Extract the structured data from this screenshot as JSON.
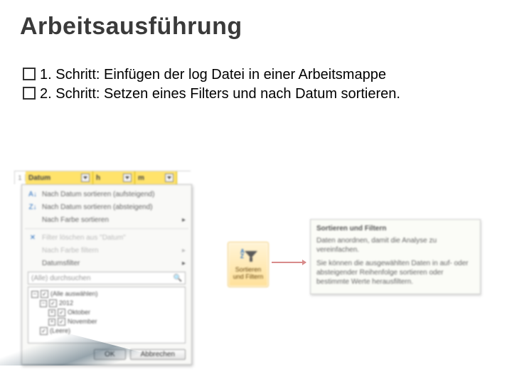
{
  "title": "Arbeitsausführung",
  "bullets": {
    "b1_lead": "1. Schritt:",
    "b1_rest": " Einfügen der log Datei in einer Arbeitsmappe",
    "b2_lead": "2. Schritt:",
    "b2_rest": " Setzen eines Filters und nach Datum sortieren."
  },
  "filter": {
    "row_no": "1",
    "col_a": "Datum",
    "col_b": "h",
    "col_c": "m",
    "menu": {
      "sort_asc": "Nach Datum sortieren (aufsteigend)",
      "sort_desc": "Nach Datum sortieren (absteigend)",
      "sort_color": "Nach Farbe sortieren",
      "clear_filter": "Filter löschen aus \"Datum\"",
      "color_filter": "Nach Farbe filtern",
      "date_filter": "Datumsfilter",
      "search_ph": "(Alle) durchsuchen",
      "tree": {
        "all": "(Alle auswählen)",
        "y": "2012",
        "m1": "Oktober",
        "m2": "November",
        "empty": "(Leere)"
      },
      "ok": "OK",
      "cancel": "Abbrechen"
    }
  },
  "ribbon": {
    "label_l1": "Sortieren",
    "label_l2": "und Filtern"
  },
  "callout": {
    "title": "Sortieren und Filtern",
    "p1": "Daten anordnen, damit die Analyse zu vereinfachen.",
    "p2": "Sie können die ausgewählten Daten in auf- oder absteigender Reihenfolge sortieren oder bestimmte Werte herausfiltern."
  }
}
